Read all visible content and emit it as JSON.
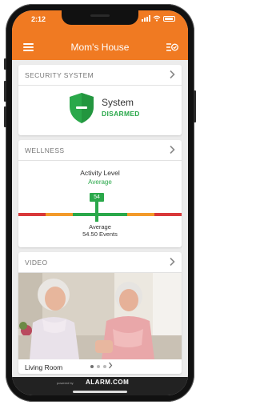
{
  "status_bar": {
    "time": "2:12"
  },
  "header": {
    "title": "Mom's House"
  },
  "security": {
    "section_title": "SECURITY SYSTEM",
    "label": "System",
    "state": "DISARMED"
  },
  "wellness": {
    "section_title": "WELLNESS",
    "metric_title": "Activity Level",
    "metric_level": "Average",
    "value": "54",
    "value_fraction": 0.48,
    "indicator_label": "Average",
    "events_label": "54.50 Events"
  },
  "video": {
    "section_title": "VIDEO",
    "camera_name": "Living Room",
    "pages": 3,
    "active_page": 1
  },
  "footer": {
    "powered_by": "powered by",
    "brand": "ALARM.COM"
  },
  "colors": {
    "brand_orange": "#f07a22",
    "status_green": "#2aa84a",
    "scale_red": "#d9383a",
    "scale_orange": "#f39a2a",
    "scale_green": "#2aa84a"
  },
  "icons": [
    "menu-icon",
    "schedule-check-icon",
    "shield-icon",
    "chevron-right-icon",
    "wifi-icon",
    "battery-icon"
  ]
}
